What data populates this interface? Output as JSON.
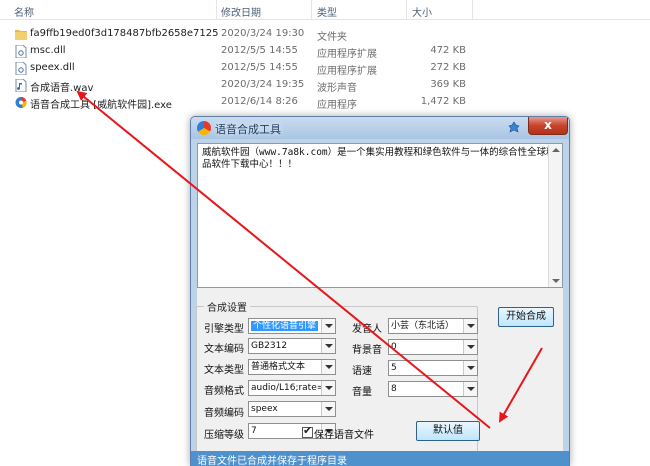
{
  "explorer": {
    "columns": {
      "name": "名称",
      "date": "修改日期",
      "type": "类型",
      "size": "大小"
    },
    "files": [
      {
        "icon": "folder-icon",
        "name": "fa9ffb19ed0f3d178487bfb2658e7125",
        "date": "2020/3/24 19:30",
        "type": "文件夹",
        "size": ""
      },
      {
        "icon": "dll-file-icon",
        "name": "msc.dll",
        "date": "2012/5/5 14:55",
        "type": "应用程序扩展",
        "size": "472 KB"
      },
      {
        "icon": "dll-file-icon",
        "name": "speex.dll",
        "date": "2012/5/5 14:55",
        "type": "应用程序扩展",
        "size": "272 KB"
      },
      {
        "icon": "wav-file-icon",
        "name": "合成语音.wav",
        "date": "2020/3/24 19:35",
        "type": "波形声音",
        "size": "369 KB"
      },
      {
        "icon": "exe-app-icon",
        "name": "语音合成工具 [威航软件园].exe",
        "date": "2012/6/14 8:26",
        "type": "应用程序",
        "size": "1,472 KB"
      }
    ]
  },
  "dialog": {
    "title": "语音合成工具",
    "close_label": "x",
    "text": "威航软件园（www.7a8k.com）是一个集实用教程和绿色软件与一体的综合性全球精品软件下载中心！！！",
    "group_title": "合成设置",
    "fields": {
      "engine": {
        "label": "引擎类型",
        "value": "个性化语音引擎"
      },
      "encoding": {
        "label": "文本编码",
        "value": "GB2312"
      },
      "text_type": {
        "label": "文本类型",
        "value": "普通格式文本"
      },
      "audio_format": {
        "label": "音频格式",
        "value": "audio/L16;rate="
      },
      "audio_codec": {
        "label": "音频编码",
        "value": "speex"
      },
      "compress_level": {
        "label": "压缩等级",
        "value": "7"
      },
      "speaker": {
        "label": "发音人",
        "value": "小芸（东北话）"
      },
      "bg_sound": {
        "label": "背景音",
        "value": "0"
      },
      "speed": {
        "label": "语速",
        "value": "5"
      },
      "volume": {
        "label": "音量",
        "value": "8"
      }
    },
    "start_button": "开始合成",
    "default_button": "默认值",
    "save_checkbox": {
      "label": "保存语音文件",
      "checked": true
    },
    "status": "语音文件已合成并保存于程序目录"
  },
  "colors": {
    "annotation_arrow": "#e8161b",
    "titlebar": "#bcd3ea",
    "statusbar": "#4f91cc"
  }
}
